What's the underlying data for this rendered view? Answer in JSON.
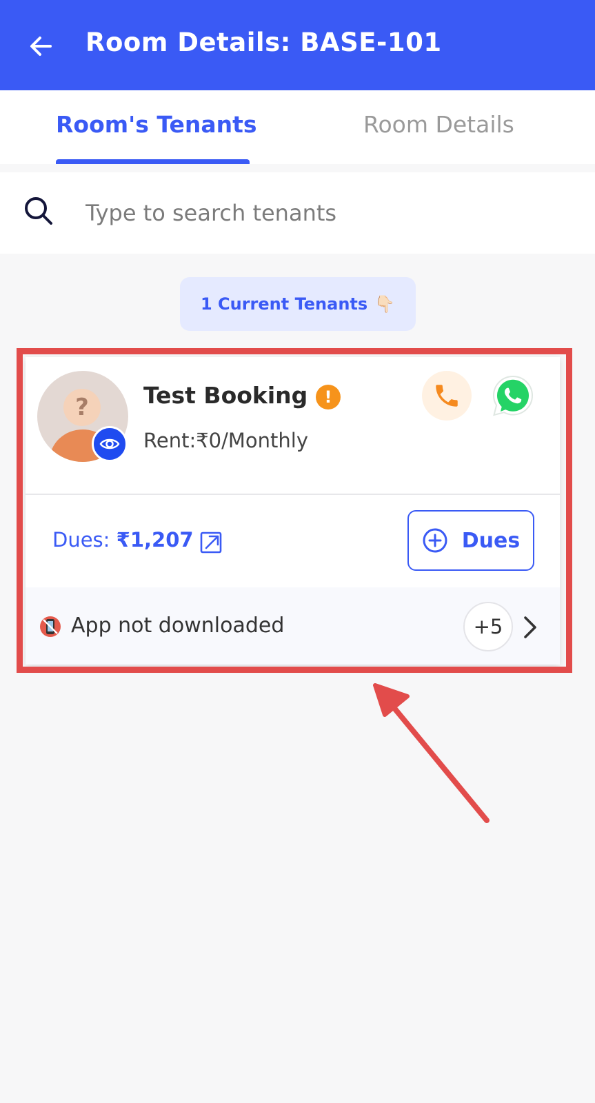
{
  "appbar": {
    "title": "Room Details: BASE-101"
  },
  "tabs": [
    {
      "label": "Room's Tenants",
      "active": true
    },
    {
      "label": "Room Details",
      "active": false
    }
  ],
  "search": {
    "placeholder": "Type to search tenants",
    "value": ""
  },
  "tenant_count": {
    "label": "1 Current Tenants",
    "emoji": "👇🏻"
  },
  "tenant": {
    "name": "Test Booking",
    "rent_label": "Rent:",
    "rent_value": "₹0/Monthly",
    "dues_label": "Dues:",
    "dues_amount": "₹1,207",
    "add_dues_label": "Dues",
    "app_status_icon": "📵",
    "app_status": "App not downloaded",
    "more_count": "+5"
  },
  "colors": {
    "primary": "#3a5af5",
    "warning": "#f6931b",
    "whatsapp": "#25d366",
    "highlight": "#e24c4b"
  },
  "icons": [
    "back-arrow-icon",
    "search-icon",
    "eye-icon",
    "warning-icon",
    "phone-icon",
    "whatsapp-icon",
    "open-external-icon",
    "plus-circle-icon",
    "app-not-downloaded-icon",
    "chevron-right-icon"
  ]
}
